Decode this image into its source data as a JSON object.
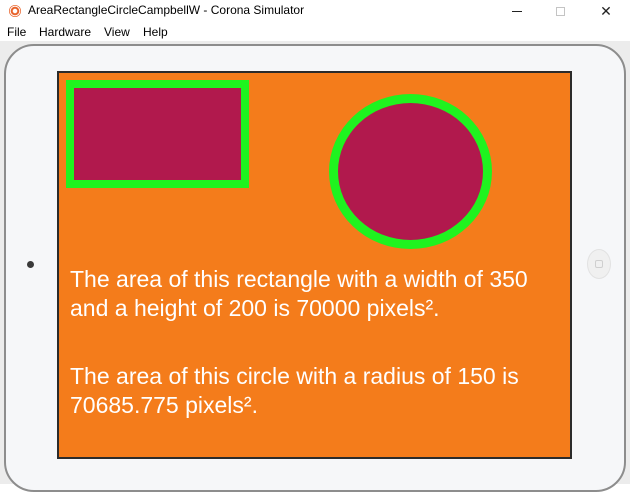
{
  "window": {
    "title": "AreaRectangleCircleCampbellW - Corona Simulator",
    "minimize_glyph": "",
    "maximize_glyph": "",
    "close_glyph": "✕"
  },
  "menu": {
    "items": [
      "File",
      "Hardware",
      "View",
      "Help"
    ]
  },
  "app": {
    "rectangle_text": "The area of this rectangle with a width of 350 and a height of 200 is 70000 pixels².",
    "circle_text": "The area of this circle with a radius of 150 is 70685.775 pixels²."
  },
  "colors": {
    "background": "#f47c1b",
    "shape_fill": "#b1194d",
    "shape_stroke": "#1ff31f",
    "text": "#ffffff"
  },
  "icons": {
    "app": "corona-simulator-icon",
    "camera": "camera-dot-icon",
    "home": "home-button-icon"
  }
}
